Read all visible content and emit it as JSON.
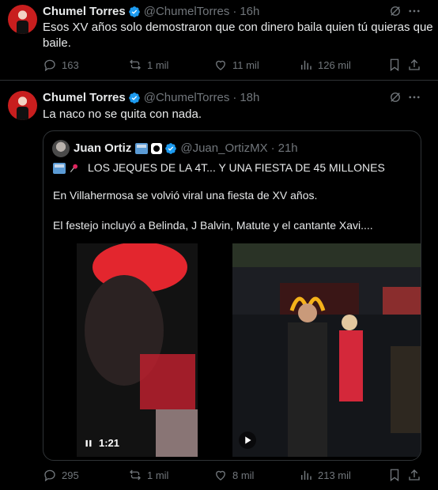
{
  "tweets": [
    {
      "author_name": "Chumel Torres",
      "handle": "@ChumelTorres",
      "separator": "·",
      "time": "16h",
      "text_lines": [
        "Esos XV años solo demostraron que con dinero baila quien tú quieras que",
        "baile."
      ],
      "replies": "163",
      "reposts": "1 mil",
      "likes": "11 mil",
      "views": "126 mil"
    },
    {
      "author_name": "Chumel Torres",
      "handle": "@ChumelTorres",
      "separator": "·",
      "time": "18h",
      "text_lines": [
        "La naco no se quita con nada."
      ],
      "replies": "295",
      "reposts": "1 mil",
      "likes": "8 mil",
      "views": "213 mil",
      "quote": {
        "author_name": "Juan Ortiz",
        "handle": "@Juan_OrtizMX",
        "separator": "·",
        "time": "21h",
        "headline": "LOS JEQUES DE LA 4T... Y UNA FIESTA DE 45 MILLONES",
        "line2": "En Villahermosa se volvió viral una fiesta de XV años.",
        "line3": "El festejo incluyó a Belinda, J Balvin, Matute y el cantante Xavi....",
        "video_duration": "1:21"
      }
    }
  ],
  "colors": {
    "background": "#000000",
    "text": "#e7e9ea",
    "muted": "#71767b",
    "border": "#2f3336",
    "verified": "#1d9bf0"
  },
  "icons": [
    "verified-badge-icon",
    "grok-icon",
    "more-icon",
    "reply-icon",
    "repost-icon",
    "like-icon",
    "views-icon",
    "bookmark-icon",
    "share-icon",
    "pause-icon",
    "play-icon"
  ]
}
